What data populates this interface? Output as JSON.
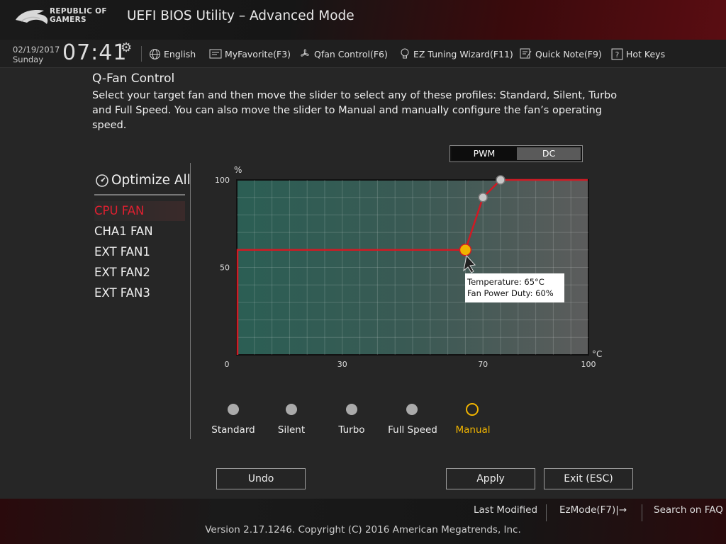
{
  "header": {
    "brand_line1": "REPUBLIC OF",
    "brand_line2": "GAMERS",
    "title": "UEFI BIOS Utility – Advanced Mode"
  },
  "toolbar": {
    "date": "02/19/2017",
    "day": "Sunday",
    "time": "07:41",
    "language": "English",
    "myfavorite": "MyFavorite(F3)",
    "qfan": "Qfan Control(F6)",
    "ez_tuning": "EZ Tuning Wizard(F11)",
    "quick_note": "Quick Note(F9)",
    "hot_keys": "Hot Keys"
  },
  "qfan": {
    "title": "Q-Fan Control",
    "description": "Select your target fan and then move the slider to select any of these profiles: Standard, Silent, Turbo and Full Speed. You can also move the slider to Manual and manually configure the fan’s operating speed.",
    "mode_pwm": "PWM",
    "mode_dc": "DC",
    "optimize_all": "Optimize All",
    "fans": [
      "CPU FAN",
      "CHA1 FAN",
      "EXT FAN1",
      "EXT FAN2",
      "EXT FAN3"
    ],
    "selected_fan": "CPU FAN",
    "tooltip_temp": "Temperature: 65°C",
    "tooltip_duty": "Fan Power Duty: 60%",
    "profiles": [
      "Standard",
      "Silent",
      "Turbo",
      "Full Speed",
      "Manual"
    ],
    "selected_profile": "Manual",
    "undo": "Undo",
    "apply": "Apply",
    "exit": "Exit (ESC)"
  },
  "chart_data": {
    "type": "line",
    "ylabel": "%",
    "xlabel": "°C",
    "x_ticks": [
      "0",
      "30",
      "70",
      "100"
    ],
    "y_ticks": [
      "100",
      "50"
    ],
    "xlim": [
      0,
      100
    ],
    "ylim": [
      0,
      100
    ],
    "series": [
      {
        "x": [
          0,
          0,
          65,
          70,
          75,
          100
        ],
        "y": [
          0,
          60,
          60,
          90,
          100,
          100
        ]
      }
    ],
    "control_points": [
      {
        "x": 65,
        "y": 60,
        "active": true
      },
      {
        "x": 70,
        "y": 90,
        "active": false
      },
      {
        "x": 75,
        "y": 100,
        "active": false
      }
    ],
    "colors": {
      "line": "#d01a24",
      "active_point": "#f0b400",
      "grid_bg_left": "#2a5a50",
      "grid_bg_right": "#5a5a5a"
    }
  },
  "footer": {
    "last_modified": "Last Modified",
    "ezmode": "EzMode(F7)|→",
    "search_faq": "Search on FAQ",
    "version": "Version 2.17.1246. Copyright (C) 2016 American Megatrends, Inc."
  },
  "colors": {
    "accent_red": "#e02030",
    "manual_orange": "#f0b400"
  }
}
